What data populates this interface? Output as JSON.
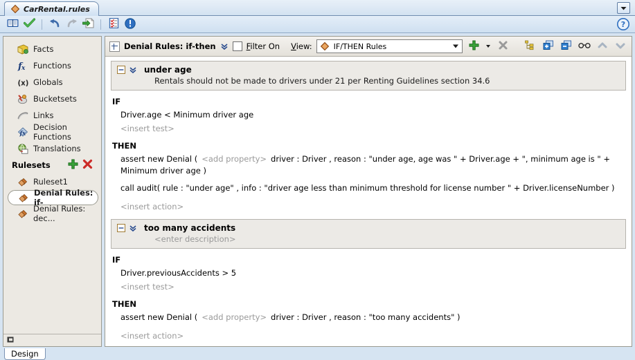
{
  "window": {
    "document_tab": "CarRental.rules",
    "tab_dropdown_icon": "chevron-down-icon",
    "diamond_icon": "rules-diamond-icon"
  },
  "toolbar": {
    "buttons": [
      {
        "name": "dictionary-button",
        "icon": "book-icon",
        "title": "Dictionary"
      },
      {
        "name": "validate-button",
        "icon": "check-icon",
        "title": "Validate"
      },
      {
        "name": "undo-button",
        "icon": "undo-icon",
        "title": "Undo"
      },
      {
        "name": "redo-button",
        "icon": "redo-icon",
        "title": "Redo"
      },
      {
        "name": "export-button",
        "icon": "export-page-icon",
        "title": "Export"
      },
      {
        "name": "tasks-button",
        "icon": "checklist-icon",
        "title": "Tasks"
      },
      {
        "name": "info-button",
        "icon": "info-icon",
        "title": "Info"
      }
    ],
    "help_icon": "help-question-icon"
  },
  "sidebar": {
    "items": [
      {
        "label": "Facts",
        "icon": "facts-icon"
      },
      {
        "label": "Functions",
        "icon": "functions-fx-icon"
      },
      {
        "label": "Globals",
        "icon": "globals-x-icon"
      },
      {
        "label": "Bucketsets",
        "icon": "bucketsets-icon"
      },
      {
        "label": "Links",
        "icon": "links-icon"
      },
      {
        "label": "Decision Functions",
        "icon": "decision-functions-icon"
      },
      {
        "label": "Translations",
        "icon": "translations-icon"
      }
    ],
    "rulesets_header": {
      "label": "Rulesets",
      "add_icon": "green-plus-icon",
      "delete_icon": "red-x-icon"
    },
    "rulesets": [
      {
        "label": "Ruleset1",
        "icon": "ruleset-diamond-icon",
        "selected": false
      },
      {
        "label": "Denial Rules: if-",
        "icon": "ruleset-diamond-icon",
        "selected": true
      },
      {
        "label": "Denial Rules: dec...",
        "icon": "ruleset-diamond-icon",
        "selected": false
      }
    ],
    "footer_icon": "collapse-panel-icon"
  },
  "editor_toolbar": {
    "expand_icon": "expand-plus-box-icon",
    "title": "Denial Rules: if-then",
    "chevrons_icon": "double-chevron-down-icon",
    "filter_checkbox_label": "Filter On",
    "filter_checked": false,
    "view_label": "View:",
    "view_value": "IF/THEN Rules",
    "view_icon": "rules-diamond-icon",
    "actions": [
      {
        "name": "add-rule-button",
        "icon": "green-plus-icon"
      },
      {
        "name": "add-rule-dropdown",
        "icon": "chevron-down-icon"
      },
      {
        "name": "delete-rule-button",
        "icon": "gray-x-icon"
      },
      {
        "name": "tree-view-button",
        "icon": "tree-structure-icon"
      },
      {
        "name": "expand-all-button",
        "icon": "expand-all-icon"
      },
      {
        "name": "collapse-all-button",
        "icon": "collapse-all-icon"
      },
      {
        "name": "show-advanced-button",
        "icon": "glasses-icon"
      },
      {
        "name": "move-up-button",
        "icon": "arrow-up-icon"
      },
      {
        "name": "move-down-button",
        "icon": "arrow-down-icon"
      }
    ]
  },
  "rules": [
    {
      "name": "under age",
      "description": "Rentals should not be made to drivers under 21 per Renting Guidelines section 34.6",
      "description_is_placeholder": false,
      "collapse_icon": "minus-box-icon",
      "chevrons_icon": "double-chevron-down-icon",
      "if_keyword": "IF",
      "tests": [
        {
          "text": "Driver.age  <  Minimum driver age",
          "placeholder": false
        },
        {
          "text": "<insert test>",
          "placeholder": true
        }
      ],
      "then_keyword": "THEN",
      "actions": [
        {
          "segments": [
            {
              "text": "assert new Denial (",
              "placeholder": false
            },
            {
              "text": "<add property>",
              "placeholder": true
            },
            {
              "text": "driver : Driver , reason : \"under age, age was \" + Driver.age + \", minimum age is \" + Minimum driver age  )",
              "placeholder": false
            }
          ]
        },
        {
          "segments": [
            {
              "text": "call audit( rule : \"under age\" , info : \"driver age less than minimum threshold for license number \" + Driver.licenseNumber )",
              "placeholder": false
            }
          ]
        },
        {
          "segments": [
            {
              "text": "<insert action>",
              "placeholder": true
            }
          ]
        }
      ]
    },
    {
      "name": "too many accidents",
      "description": "<enter description>",
      "description_is_placeholder": true,
      "collapse_icon": "minus-box-icon",
      "chevrons_icon": "double-chevron-down-icon",
      "if_keyword": "IF",
      "tests": [
        {
          "text": "Driver.previousAccidents  >  5",
          "placeholder": false
        },
        {
          "text": "<insert test>",
          "placeholder": true
        }
      ],
      "then_keyword": "THEN",
      "actions": [
        {
          "segments": [
            {
              "text": "assert new Denial (",
              "placeholder": false
            },
            {
              "text": "<add property>",
              "placeholder": true
            },
            {
              "text": "driver : Driver , reason : \"too many accidents\"  )",
              "placeholder": false
            }
          ]
        },
        {
          "segments": [
            {
              "text": "<insert action>",
              "placeholder": true
            }
          ]
        }
      ]
    }
  ],
  "bottom_tabs": [
    {
      "label": "Design",
      "selected": true
    }
  ],
  "colors": {
    "window_bg": "#d6e4f2",
    "panel_bg": "#ece9e3",
    "rule_header_bg": "#eceae6",
    "accent_blue": "#2b4d8f",
    "diamond_orange": "#d2762e",
    "plus_green": "#3aa33a",
    "x_red": "#cc2b27",
    "placeholder_gray": "#9a9a9a"
  }
}
